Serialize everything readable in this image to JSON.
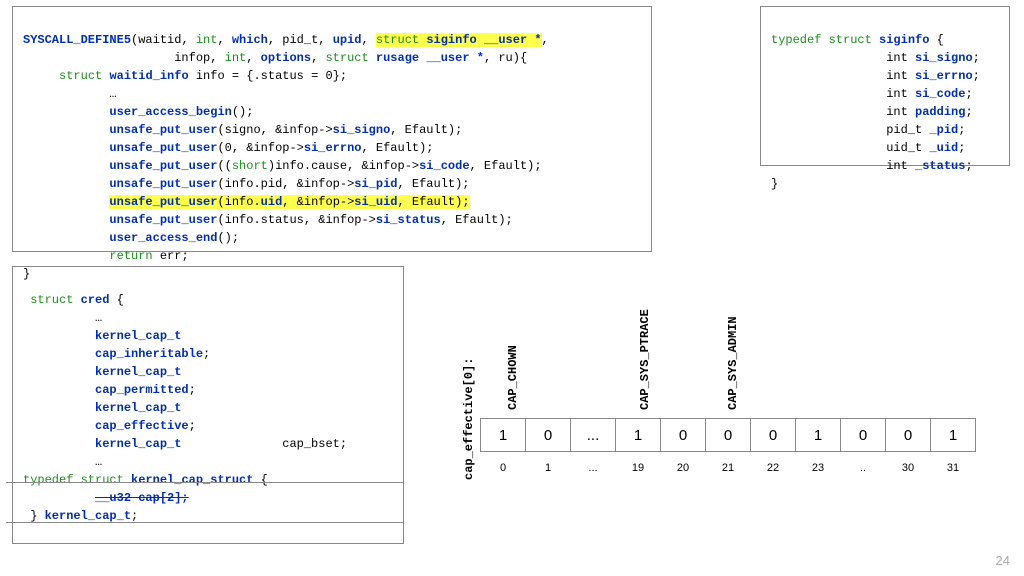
{
  "syscall": {
    "l1a": "SYSCALL_DEFINE5",
    "l1b": "(waitid, ",
    "l1c": "int",
    "l1d": ", ",
    "l1e": "which",
    "l1f": ", pid_t, ",
    "l1g": "upid",
    "l1h": ", ",
    "l1i": "struct ",
    "l1j": "siginfo __user *",
    "l1k": ",",
    "l2a": "                     infop, ",
    "l2b": "int",
    "l2c": ", ",
    "l2d": "options",
    "l2e": ", ",
    "l2f": "struct ",
    "l2g": "rusage __user *",
    "l2h": ", ru){",
    "l3a": "struct ",
    "l3b": "waitid_info",
    "l3c": " info = {.status = 0};",
    "l4": "            …",
    "l5a": "            ",
    "l5b": "user_access_begin",
    "l5c": "();",
    "l6a": "            ",
    "l6b": "unsafe_put_user",
    "l6c": "(signo, &infop->",
    "l6d": "si_signo",
    "l6e": ", Efault);",
    "l7a": "            ",
    "l7b": "unsafe_put_user",
    "l7c": "(0, &infop->",
    "l7d": "si_errno",
    "l7e": ", Efault);",
    "l8a": "            ",
    "l8b": "unsafe_put_user",
    "l8c": "((",
    "l8d": "short",
    "l8e": ")info.cause, &infop->",
    "l8f": "si_code",
    "l8g": ", Efault);",
    "l9a": "            ",
    "l9b": "unsafe_put_user",
    "l9c": "(info.pid, &infop->",
    "l9d": "si_pid",
    "l9e": ", Efault);",
    "l10a": "            ",
    "l10b": "unsafe_put_user",
    "l10c": "(info.",
    "l10d": "uid",
    "l10e": ", &infop->",
    "l10f": "si_uid",
    "l10g": ", Efault);",
    "l11a": "            ",
    "l11b": "unsafe_put_user",
    "l11c": "(info.status, &infop->",
    "l11d": "si_status",
    "l11e": ", Efault);",
    "l12a": "            ",
    "l12b": "user_access_end",
    "l12c": "();",
    "l13a": "            ",
    "l13b": "return",
    "l13c": " err;",
    "l14": "}"
  },
  "siginfo": {
    "l1a": "typedef struct ",
    "l1b": "siginfo",
    "l1c": " {",
    "l2a": "                int ",
    "l2b": "si_signo",
    "l2c": ";",
    "l3a": "                int ",
    "l3b": "si_errno",
    "l3c": ";",
    "l4a": "                int ",
    "l4b": "si_code",
    "l4c": ";",
    "l5a": "                int ",
    "l5b": "padding",
    "l5c": ";",
    "l6a": "                pid_t ",
    "l6b": "_pid",
    "l6c": ";",
    "l7a": "                uid_t ",
    "l7b": "_uid",
    "l7c": ";",
    "l8a": "                int ",
    "l8b": "_status",
    "l8c": ";",
    "l9": "}"
  },
  "cred": {
    "l1a": " struct ",
    "l1b": "cred",
    "l1c": " {",
    "l2": "          …",
    "l3a": "          ",
    "l3b": "kernel_cap_t",
    "l4a": "          ",
    "l4b": "cap_inheritable",
    "l4c": ";",
    "l5a": "          ",
    "l5b": "kernel_cap_t",
    "l6a": "          ",
    "l6b": "cap_permitted",
    "l6c": ";",
    "l7a": "          ",
    "l7b": "kernel_cap_t",
    "l8a": "          ",
    "l8b": "cap_effective",
    "l8c": ";",
    "l9a": "          ",
    "l9b": "kernel_cap_t",
    "l9c": "              cap_bset;",
    "l10": "          …",
    "l11a": "typedef struct ",
    "l11b": "kernel_cap_struct",
    "l11c": " {",
    "l12a": "          ",
    "l12b": "__u32 cap[2];",
    "l13a": " } ",
    "l13b": "kernel_cap_t",
    "l13c": ";"
  },
  "bits": {
    "ylabel": "cap_effective[0]:",
    "labels": [
      "CAP_CHOWN",
      "",
      "",
      "CAP_SYS_PTRACE",
      "",
      "CAP_SYS_ADMIN",
      "",
      "",
      "",
      "",
      ""
    ],
    "vals": [
      "1",
      "0",
      "...",
      "1",
      "0",
      "0",
      "0",
      "1",
      "0",
      "0",
      "1"
    ],
    "idx": [
      "0",
      "1",
      "...",
      "19",
      "20",
      "21",
      "22",
      "23",
      "..",
      "30",
      "31"
    ]
  },
  "pagenum": "24"
}
